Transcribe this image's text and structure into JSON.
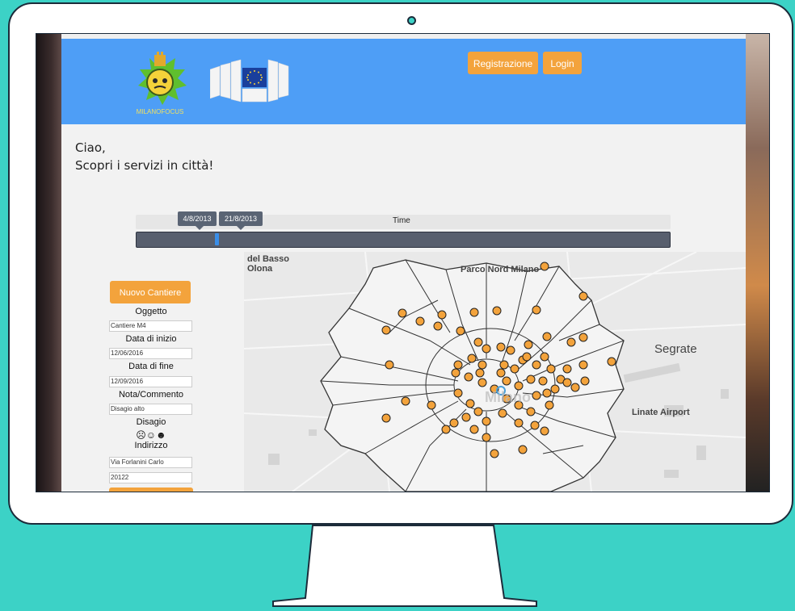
{
  "header": {
    "logo_caption": "MILANOFOCUS",
    "register_label": "Registrazione",
    "login_label": "Login"
  },
  "greeting": {
    "line1": "Ciao,",
    "line2": "Scopri i servizi in città!"
  },
  "timeline": {
    "title": "Time",
    "start_date": "4/8/2013",
    "end_date": "21/8/2013"
  },
  "form": {
    "new_site_button": "Nuovo Cantiere",
    "object_label": "Oggetto",
    "object_value": "Cantiere M4",
    "start_label": "Data di inizio",
    "start_value": "12/06/2016",
    "end_label": "Data di fine",
    "end_value": "12/09/2016",
    "note_label": "Nota/Commento",
    "note_value": "Disagio alto",
    "disruption_label": "Disagio",
    "disruption_icons": "☹☺☻",
    "address_label": "Indirizzo",
    "address_value": "Via Forlanini Carlo",
    "zip_value": "20122"
  },
  "map": {
    "labels": [
      "del Basso",
      "Olona",
      "Parco Nord Milano",
      "Segrate",
      "Linate Airport",
      "Milano"
    ]
  },
  "colors": {
    "background": "#3cd2c6",
    "header": "#4e9ef6",
    "accent_orange": "#f3a33c"
  }
}
